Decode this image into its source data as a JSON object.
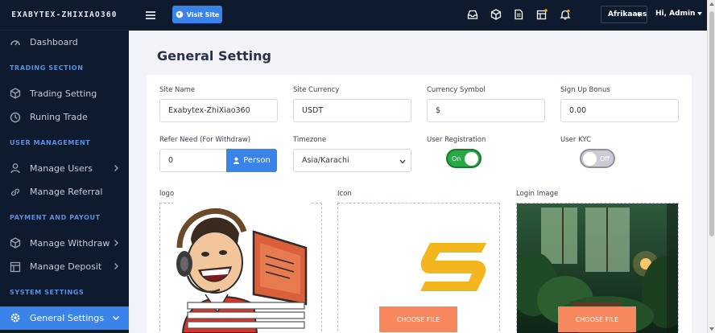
{
  "brand": "EXABYTEX-ZHIXIAO360",
  "sidebar": {
    "dashboard": "Dashboard",
    "sections": {
      "trading": "TRADING SECTION",
      "user_mgmt": "USER MANAGEMENT",
      "payment": "PAYMENT AND PAYOUT",
      "system": "SYSTEM SETTINGS"
    },
    "items": {
      "trading_setting": "Trading Setting",
      "runing_trade": "Runing Trade",
      "manage_users": "Manage Users",
      "manage_referral": "Manage Referral",
      "manage_withdraw": "Manage Withdraw",
      "manage_deposit": "Manage Deposit",
      "general_settings": "General Settings"
    }
  },
  "topbar": {
    "visit_site": "Visit Site",
    "language": "Afrikaans",
    "user": "Hi, Admin"
  },
  "page": {
    "title": "General Setting"
  },
  "form": {
    "site_name": {
      "label": "Site Name",
      "value": "Exabytex-ZhiXiao360"
    },
    "site_currency": {
      "label": "Site Currency",
      "value": "USDT"
    },
    "currency_symbol": {
      "label": "Currency Symbol",
      "value": "$"
    },
    "sign_up_bonus": {
      "label": "Sign Up Bonus",
      "value": "0.00"
    },
    "refer_need": {
      "label": "Refer Need (For Withdraw)",
      "value": "0",
      "addon": "Person"
    },
    "timezone": {
      "label": "Timezone",
      "value": "Asia/Karachi"
    },
    "user_registration": {
      "label": "User Registration",
      "state": "On"
    },
    "user_kyc": {
      "label": "User KYC",
      "state": "Off"
    },
    "logo": {
      "label": "logo"
    },
    "icon": {
      "label": "Icon",
      "button": "CHOOSE FILE"
    },
    "login_image": {
      "label": "Login Image",
      "button": "CHOOSE FILE"
    }
  },
  "colors": {
    "sidebar_bg": "#0e1a2e",
    "accent": "#3a83e8",
    "toggle_on": "#28a745",
    "choose_btn": "#f7875c",
    "section_label": "#5d8fe0"
  }
}
